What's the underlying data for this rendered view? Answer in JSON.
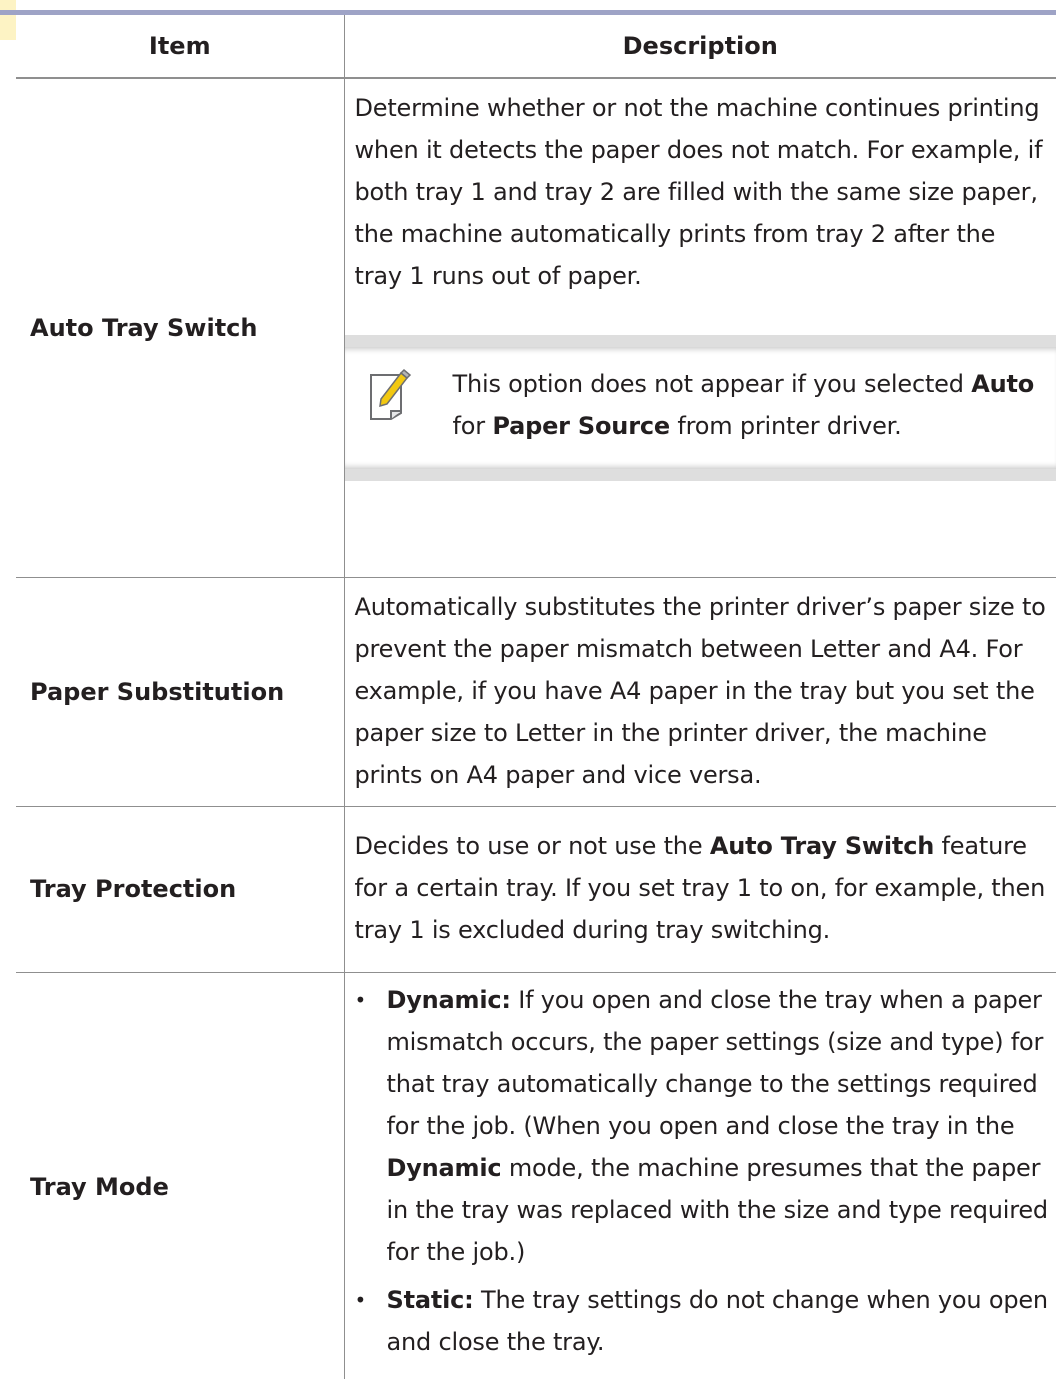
{
  "table": {
    "headers": {
      "item": "Item",
      "description": "Description"
    },
    "rows": {
      "auto_tray_switch": {
        "item": "Auto Tray Switch",
        "description": "Determine whether or not the machine continues printing when it detects the paper does not match. For example, if both tray 1 and tray 2 are filled with the same size paper, the machine automatically prints from tray 2 after the tray 1 runs out of paper.",
        "note": {
          "text_1": "This option does not appear if you selected",
          "bold_1": "Auto",
          "text_2": "for",
          "bold_2": "Paper Source",
          "text_3": "from printer driver."
        }
      },
      "paper_substitution": {
        "item": "Paper Substitution",
        "description": "Automatically substitutes the printer driver’s paper size to prevent the paper mismatch between Letter and A4. For example, if you have A4 paper in the tray but you set the paper size to Letter in the printer driver, the machine prints on A4 paper and vice versa."
      },
      "tray_protection": {
        "item": "Tray Protection",
        "text_1": "Decides to use or not use the",
        "bold_1": "Auto Tray Switch",
        "text_2": "feature for a certain tray. If you set tray 1 to on, for example, then tray 1 is excluded during tray switching."
      },
      "tray_mode": {
        "item": "Tray Mode",
        "bullet": "•",
        "dynamic": {
          "label": "Dynamic:",
          "text_1": "If you open and close the tray when a paper mismatch occurs, the paper settings (size and type) for that tray automatically change to the settings required for the job. (When you open and close the tray in the",
          "bold": "Dynamic",
          "text_2": "mode, the machine presumes that the paper in the tray was replaced with the size and type required for the job.)"
        },
        "static": {
          "label": "Static:",
          "text": "The tray settings do not change when you open and close the tray."
        }
      }
    }
  },
  "icons": {
    "note": "note-pencil-icon"
  },
  "colors": {
    "rule": "#9ea3c6",
    "border": "#8f8f8f",
    "note_band": "#dedede",
    "text": "#231f20"
  }
}
